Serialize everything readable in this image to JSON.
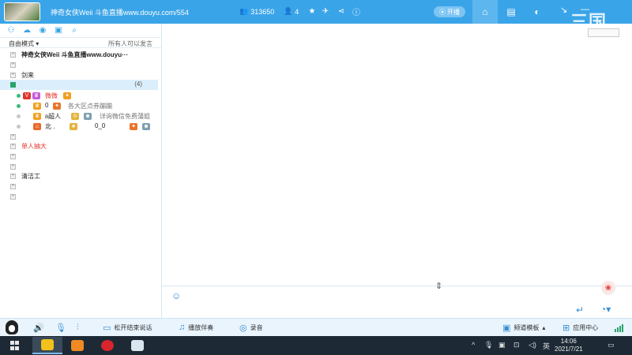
{
  "titlebar": {
    "channel_title": "神奇女侠Weii 斗鱼直播www.douyu.com/554",
    "members": "313650",
    "online": "4",
    "open_button": "开播",
    "watermark": "三国",
    "accent": "#3aa4e8"
  },
  "left": {
    "mode": "自由模式",
    "mode_note": "所有人可以发言",
    "tree": [
      {
        "label": "神奇女侠Weii 斗鱼直播www.douyu···"
      },
      {
        "label": ""
      },
      {
        "label": "剑来"
      },
      {
        "label": "",
        "count": "(4)"
      }
    ],
    "users": [
      {
        "name": "微微"
      },
      {
        "name": "0",
        "note": "各大区点券蹦蹦"
      },
      {
        "name": "ʚ超人",
        "note": "详询微信免费蒲姐"
      },
      {
        "name": "北  .",
        "note": "0_0"
      }
    ],
    "tree2": [
      {
        "label": ""
      },
      {
        "label": "单人抽大",
        "red": true
      },
      {
        "label": ""
      },
      {
        "label": ""
      },
      {
        "label": "清洁工"
      },
      {
        "label": ""
      },
      {
        "label": ""
      }
    ]
  },
  "toolbar": {
    "talk_mode": "松开结束说话",
    "play_music": "播放伴奏",
    "record": "录音",
    "channel_template": "频道模板",
    "app_center": "应用中心"
  },
  "taskbar": {
    "ime": "英",
    "time": "14:06",
    "date": "2021/7/21"
  }
}
